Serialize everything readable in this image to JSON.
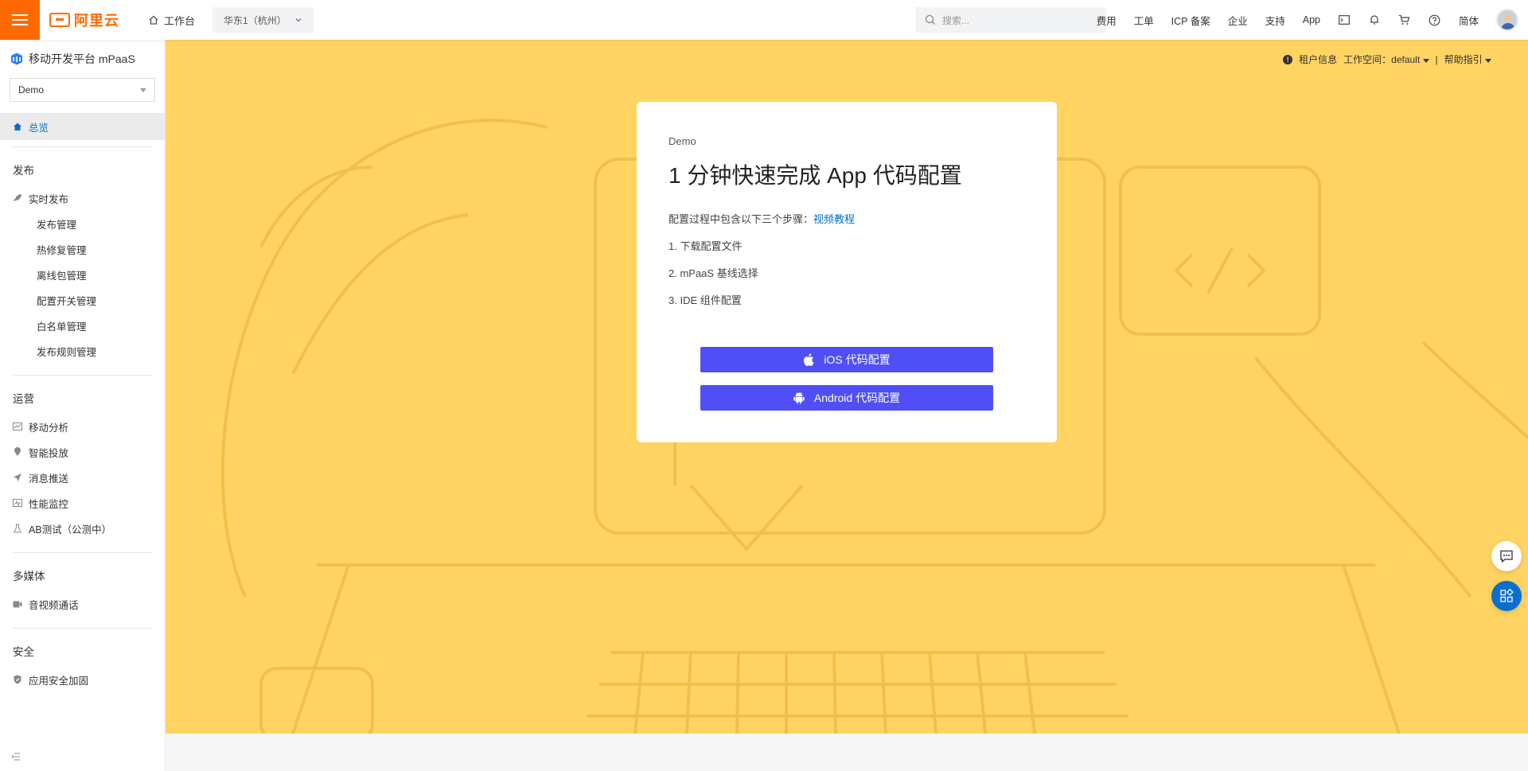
{
  "topbar": {
    "logo_text": "阿里云",
    "workbench": "工作台",
    "region": "华东1（杭州）",
    "search_placeholder": "搜索...",
    "links": [
      "费用",
      "工单",
      "ICP 备案",
      "企业",
      "支持",
      "App"
    ],
    "lang": "简体"
  },
  "sidebar": {
    "product": "移动开发平台 mPaaS",
    "app_select": "Demo",
    "overview": "总览",
    "groups": [
      {
        "title": "发布",
        "items": [
          "实时发布"
        ],
        "subs": [
          "发布管理",
          "热修复管理",
          "离线包管理",
          "配置开关管理",
          "白名单管理",
          "发布规则管理"
        ]
      },
      {
        "title": "运营",
        "items": [
          "移动分析",
          "智能投放",
          "消息推送",
          "性能监控",
          "AB测试（公测中）"
        ]
      },
      {
        "title": "多媒体",
        "items": [
          "音视频通话"
        ]
      },
      {
        "title": "安全",
        "items": [
          "应用安全加固"
        ]
      }
    ]
  },
  "main_header": {
    "tenant": "租户信息",
    "workspace": "工作空间：default",
    "sep": "|",
    "help": "帮助指引"
  },
  "card": {
    "app_name": "Demo",
    "title": "1 分钟快速完成 App 代码配置",
    "desc": "配置过程中包含以下三个步骤：",
    "link": "视频教程",
    "steps": [
      "1. 下载配置文件",
      "2. mPaaS 基线选择",
      "3. IDE 组件配置"
    ],
    "ios_button": "iOS 代码配置",
    "android_button": "Android 代码配置"
  },
  "colors": {
    "brand": "#ff6a00",
    "main_bg": "#ffd462",
    "button": "#4f4ff5",
    "link": "#0070cc"
  }
}
